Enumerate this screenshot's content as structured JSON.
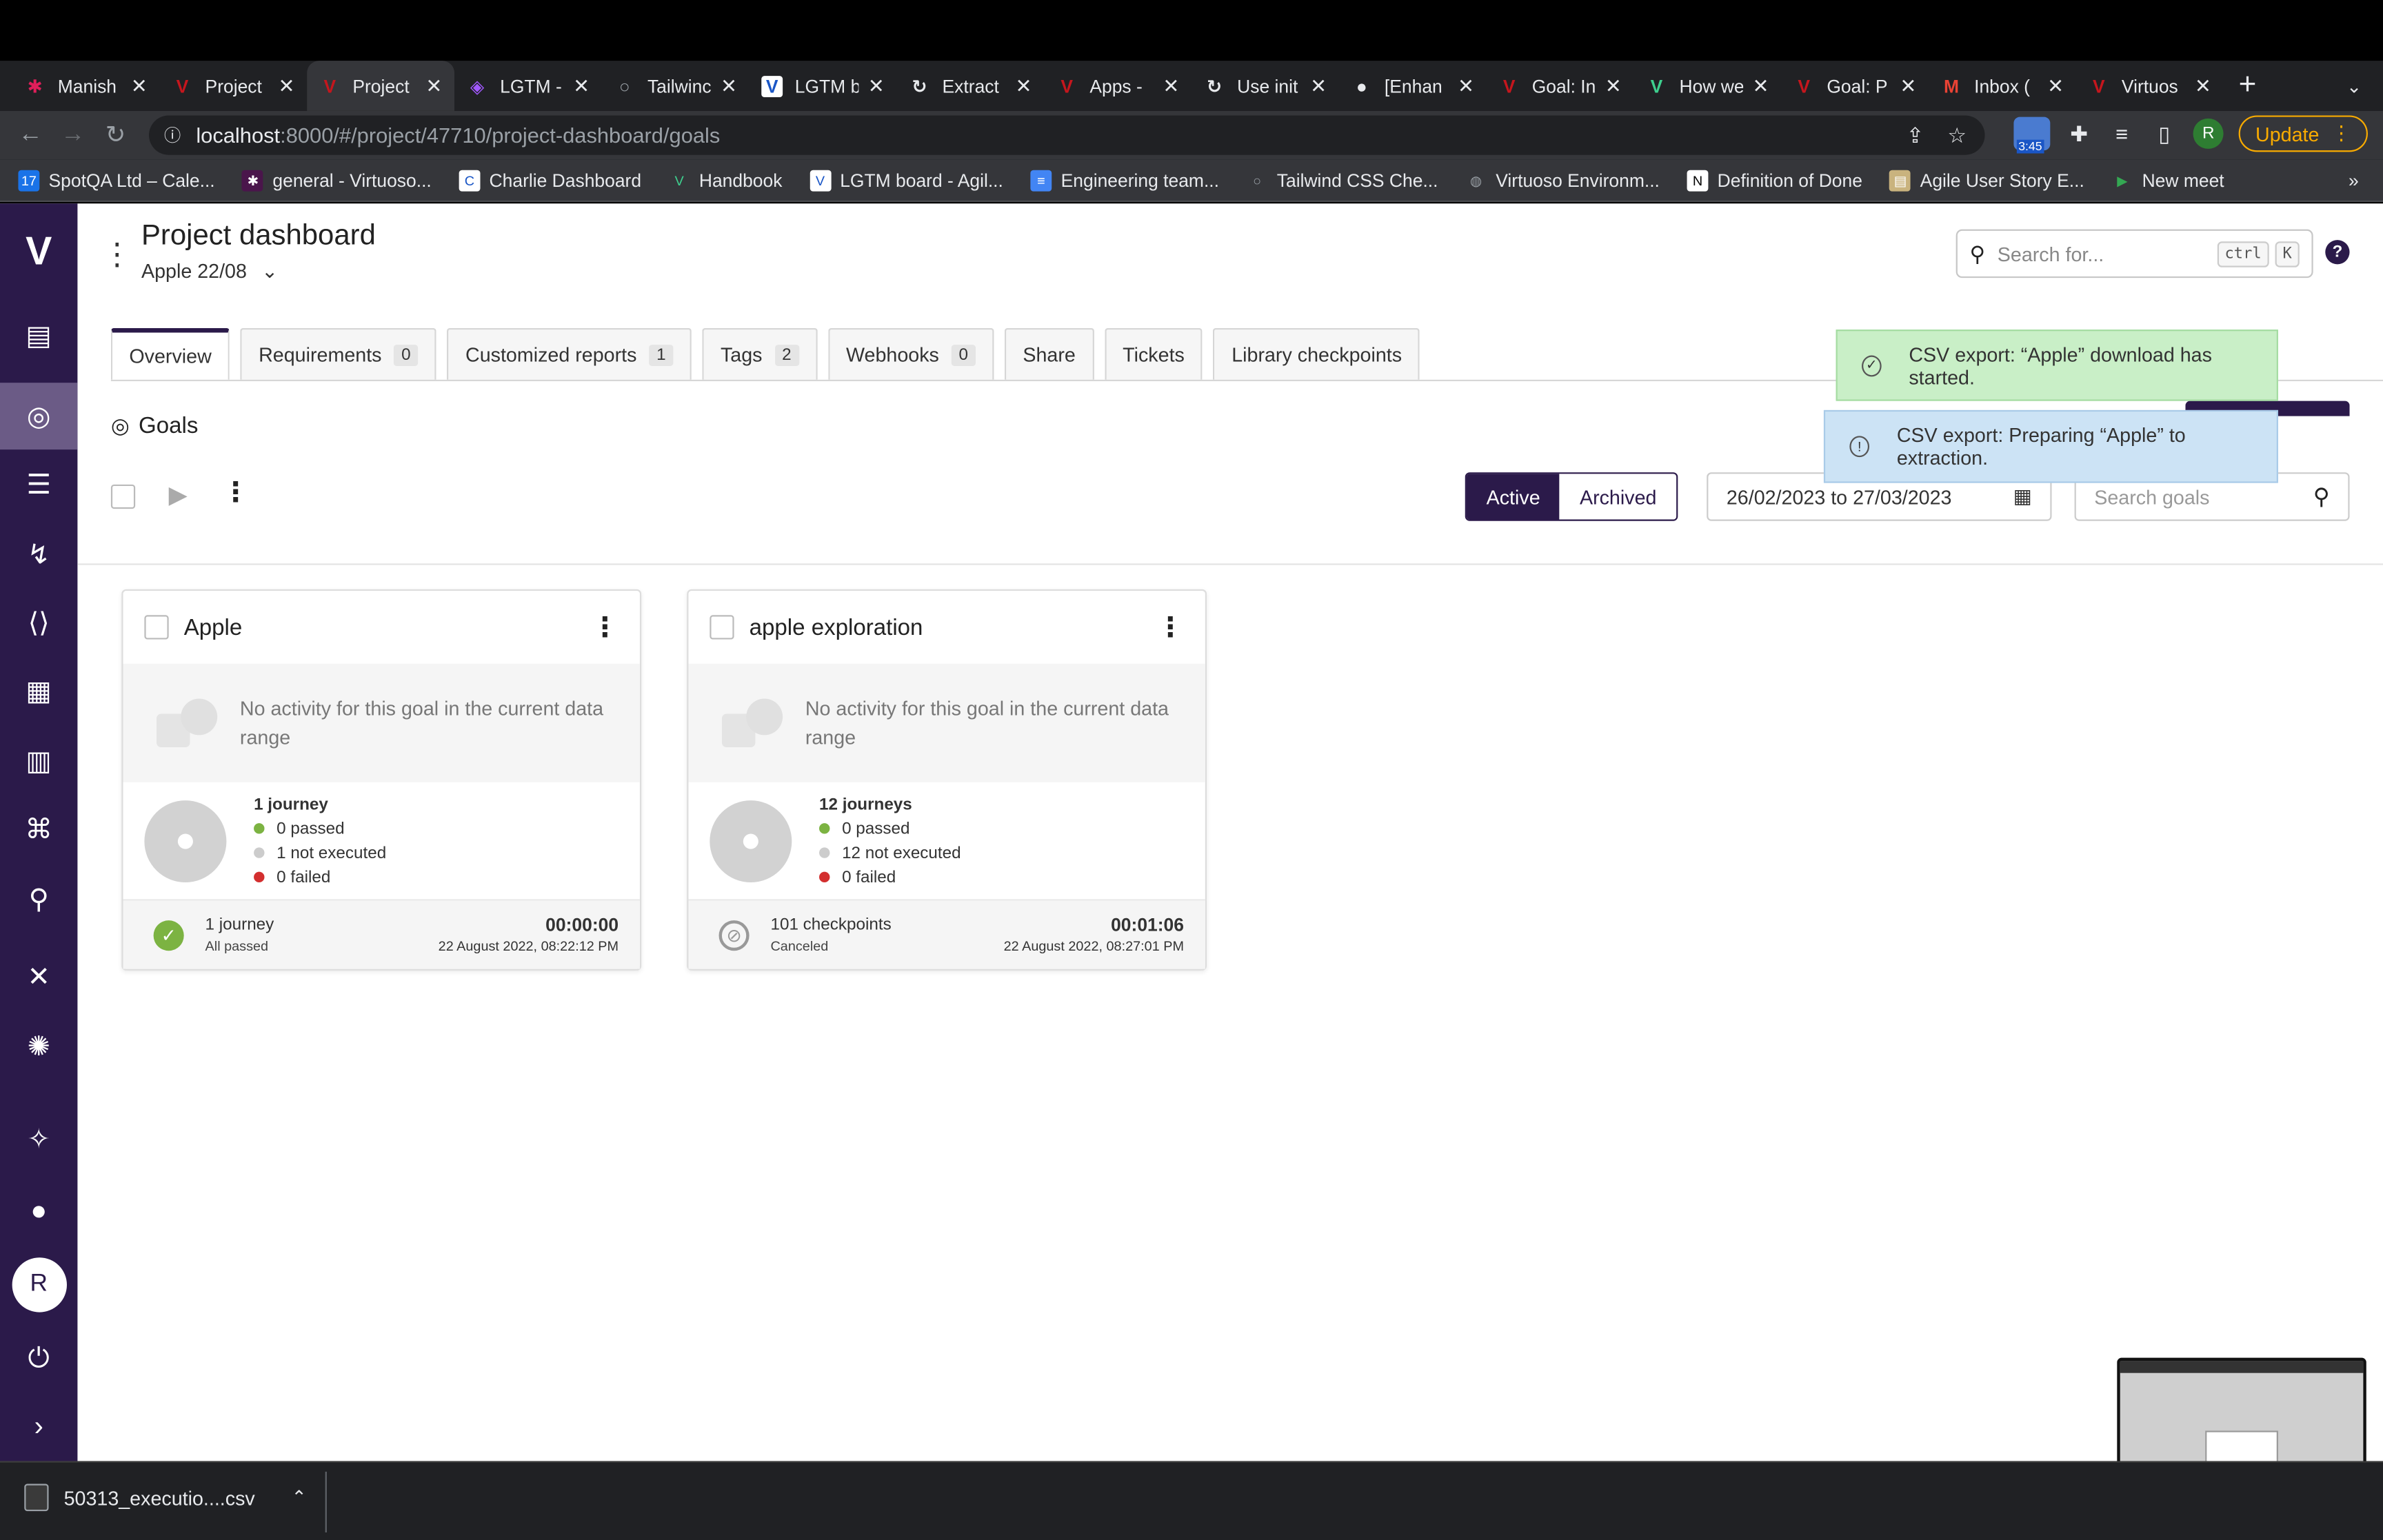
{
  "browser": {
    "tabs": [
      {
        "title": "Manish",
        "favicon": "slack-icon",
        "color": "#e01e5a"
      },
      {
        "title": "Project",
        "favicon": "virtuoso-icon",
        "color": "#c5161d"
      },
      {
        "title": "Project",
        "favicon": "virtuoso-icon",
        "color": "#c5161d"
      },
      {
        "title": "LGTM -",
        "favicon": "figma-icon",
        "color": "#a259ff"
      },
      {
        "title": "Tailwinc",
        "favicon": "search-icon",
        "color": "#9aa0a6"
      },
      {
        "title": "LGTM b",
        "favicon": "virtuoso-board-icon",
        "color": "#1a56c6"
      },
      {
        "title": "Extract",
        "favicon": "refresh-icon",
        "color": "#e8eaed"
      },
      {
        "title": "Apps -",
        "favicon": "virtuoso-icon",
        "color": "#c5161d"
      },
      {
        "title": "Use init",
        "favicon": "refresh-icon",
        "color": "#e8eaed"
      },
      {
        "title": "[Enhan",
        "favicon": "github-icon",
        "color": "#e8eaed"
      },
      {
        "title": "Goal: In",
        "favicon": "virtuoso-icon",
        "color": "#c5161d"
      },
      {
        "title": "How we",
        "favicon": "handbook-icon",
        "color": "#3ecf8e"
      },
      {
        "title": "Goal: P",
        "favicon": "virtuoso-icon",
        "color": "#c5161d"
      },
      {
        "title": "Inbox (",
        "favicon": "gmail-icon",
        "color": "#ea4335"
      },
      {
        "title": "Virtuos",
        "favicon": "virtuoso-icon",
        "color": "#c5161d"
      }
    ],
    "url_host": "localhost",
    "url_rest": ":8000/#/project/47710/project-dashboard/goals",
    "extension_badge": "3:45",
    "profile_initial": "R",
    "update_label": "Update",
    "bookmarks": [
      "SpotQA Ltd – Cale...",
      "general - Virtuoso...",
      "Charlie Dashboard",
      "Handbook",
      "LGTM board - Agil...",
      "Engineering team...",
      "Tailwind CSS Che...",
      "Virtuoso Environm...",
      "Definition of Done",
      "Agile User Story E...",
      "New meet"
    ],
    "bookmarks_more": "»"
  },
  "header": {
    "title": "Project dashboard",
    "project": "Apple 22/08",
    "search_placeholder": "Search for...",
    "search_kbd1": "ctrl",
    "search_kbd2": "K",
    "help": "?"
  },
  "tabs": [
    {
      "label": "Overview",
      "count": null
    },
    {
      "label": "Requirements",
      "count": "0"
    },
    {
      "label": "Customized reports",
      "count": "1"
    },
    {
      "label": "Tags",
      "count": "2"
    },
    {
      "label": "Webhooks",
      "count": "0"
    },
    {
      "label": "Share",
      "count": null
    },
    {
      "label": "Tickets",
      "count": null
    },
    {
      "label": "Library checkpoints",
      "count": null
    }
  ],
  "goals": {
    "title": "Goals",
    "active_label": "Active",
    "archived_label": "Archived",
    "date_range": "26/02/2023 to 27/03/2023",
    "search_placeholder": "Search goals"
  },
  "cards": [
    {
      "name": "Apple",
      "no_activity": "No activity for this goal in the current data range",
      "journeys": "1 journey",
      "passed": "0 passed",
      "not_executed": "1 not executed",
      "failed": "0 failed",
      "foot_main": "1 journey",
      "foot_sub": "All passed",
      "duration": "00:00:00",
      "date": "22 August 2022, 08:22:12 PM",
      "status": "passed"
    },
    {
      "name": "apple exploration",
      "no_activity": "No activity for this goal in the current data range",
      "journeys": "12 journeys",
      "passed": "0 passed",
      "not_executed": "12 not executed",
      "failed": "0 failed",
      "foot_main": "101 checkpoints",
      "foot_sub": "Canceled",
      "duration": "00:01:06",
      "date": "22 August 2022, 08:27:01 PM",
      "status": "canceled"
    }
  ],
  "toasts": {
    "success": "CSV export: “Apple” download has started.",
    "info": "CSV export: Preparing “Apple” to extraction."
  },
  "download": {
    "filename": "50313_executio....csv"
  },
  "colors": {
    "brand": "#2b1a4a",
    "passed": "#7cb342",
    "not_executed": "#cccccc",
    "failed": "#d32f2f",
    "toast_success": "#c9efc7",
    "toast_info": "#cce3f5"
  }
}
